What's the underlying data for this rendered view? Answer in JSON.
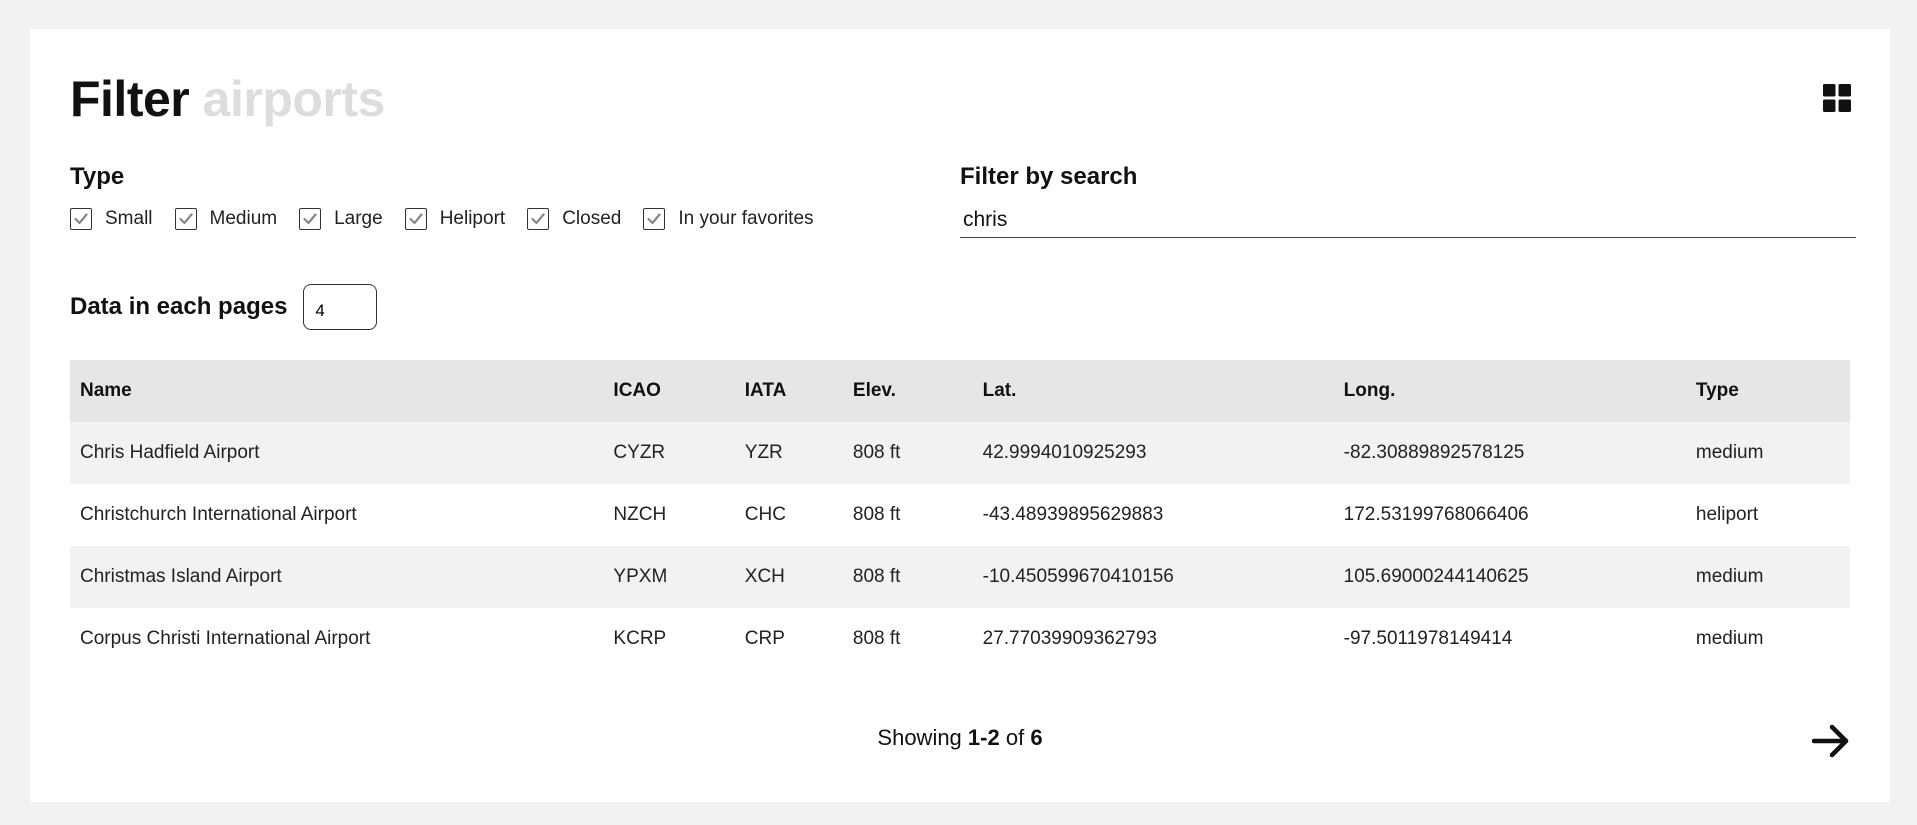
{
  "header": {
    "title_primary": "Filter",
    "title_secondary": "airports",
    "view_toggle_icon": "grid-icon"
  },
  "type_filter": {
    "label": "Type",
    "options": [
      {
        "label": "Small",
        "checked": true
      },
      {
        "label": "Medium",
        "checked": true
      },
      {
        "label": "Large",
        "checked": true
      },
      {
        "label": "Heliport",
        "checked": true
      },
      {
        "label": "Closed",
        "checked": true
      },
      {
        "label": "In your favorites",
        "checked": true
      }
    ]
  },
  "search": {
    "label": "Filter by search",
    "value": "chris"
  },
  "page_size": {
    "label": "Data in each pages",
    "value": "4"
  },
  "table": {
    "columns": [
      "Name",
      "ICAO",
      "IATA",
      "Elev.",
      "Lat.",
      "Long.",
      "Type"
    ],
    "rows": [
      [
        "Chris Hadfield Airport",
        "CYZR",
        "YZR",
        "808 ft",
        "42.9994010925293",
        "-82.30889892578125",
        "medium"
      ],
      [
        "Christchurch International Airport",
        "NZCH",
        "CHC",
        "808 ft",
        "-43.48939895629883",
        "172.53199768066406",
        "heliport"
      ],
      [
        "Christmas Island Airport",
        "YPXM",
        "XCH",
        "808 ft",
        "-10.450599670410156",
        "105.69000244140625",
        "medium"
      ],
      [
        "Corpus Christi International Airport",
        "KCRP",
        "CRP",
        "808 ft",
        "27.77039909362793",
        "-97.5011978149414",
        "medium"
      ]
    ]
  },
  "pagination": {
    "prefix": "Showing",
    "range": "1-2",
    "of_word": "of",
    "total": "6",
    "next_icon": "arrow-right-icon"
  },
  "colors": {
    "page_background": "#f2f2f2",
    "card_background": "#ffffff",
    "title_muted": "#dddddd",
    "table_header": "#e6e6e6",
    "table_row_alt": "#f2f2f2"
  }
}
